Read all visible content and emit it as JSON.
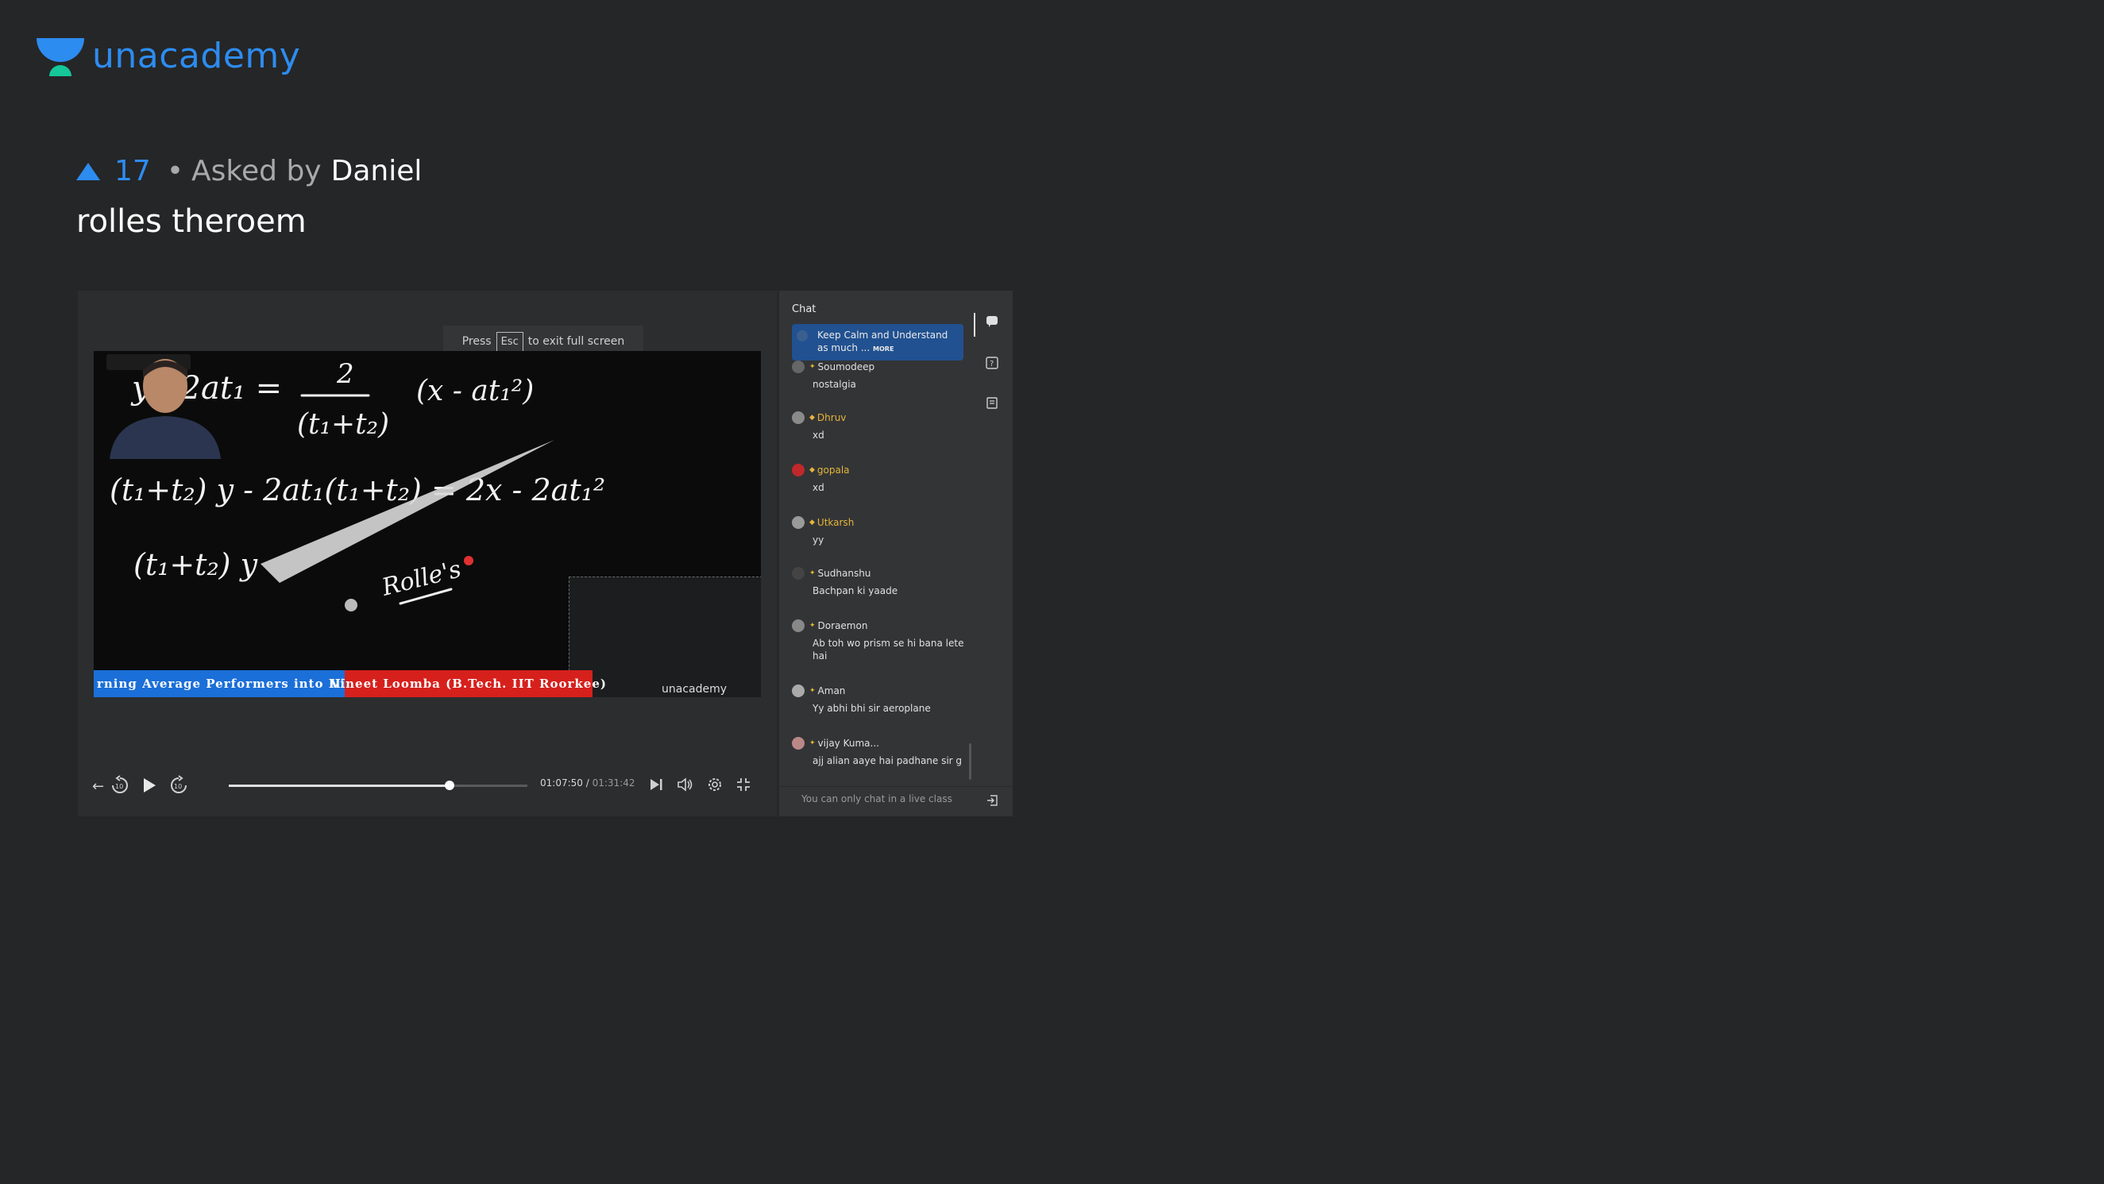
{
  "brand": {
    "name": "unacademy",
    "color": "#2d8cf0"
  },
  "question": {
    "upvotes": "17",
    "separator": "•",
    "asked_by_label": "Asked by",
    "author": "Daniel",
    "title": "rolles theroem"
  },
  "player": {
    "esc_prefix": "Press",
    "esc_key": "Esc",
    "esc_suffix": "to exit full screen",
    "current_time": "01:07:50",
    "time_separator": "/",
    "total_time": "01:31:42",
    "progress": 0.74,
    "ticker_left": "rning Average Performers into IITians",
    "ticker_right": "Vineet Loomba (B.Tech. IIT Roorkee)",
    "board_logo": "unacademy",
    "board_lines": [
      "y - 2at₁ = 2/(t₁+t₂) (x - at₁²)",
      "(t₁+t₂) y - 2at₁(t₁+t₂) = 2x - 2at₁²",
      "(t₁+t₂) y",
      "Rolle's"
    ]
  },
  "chat": {
    "title": "Chat",
    "pinned": {
      "text": "Keep Calm and Understand as much ...",
      "more": "MORE"
    },
    "messages": [
      {
        "name": "Soumodeep",
        "text": "nostalgia",
        "color": "#e0e0e0"
      },
      {
        "name": "Dhruv",
        "text": "xd",
        "color": "#e4b53a"
      },
      {
        "name": "gopala",
        "text": "xd",
        "color": "#e4b53a"
      },
      {
        "name": "Utkarsh",
        "text": "yy",
        "color": "#e4b53a"
      },
      {
        "name": "Sudhanshu",
        "text": "Bachpan ki yaade",
        "color": "#e0e0e0"
      },
      {
        "name": "Doraemon",
        "text": "Ab toh wo prism se hi bana lete hai",
        "color": "#e0e0e0"
      },
      {
        "name": "Aman",
        "text": "Yy abhi bhi sir aeroplane",
        "color": "#e0e0e0"
      },
      {
        "name": "vijay Kuma...",
        "text": "ajj alian aaye hai padhane sir g",
        "color": "#e0e0e0"
      }
    ],
    "footer": "You can only chat in a live class"
  }
}
